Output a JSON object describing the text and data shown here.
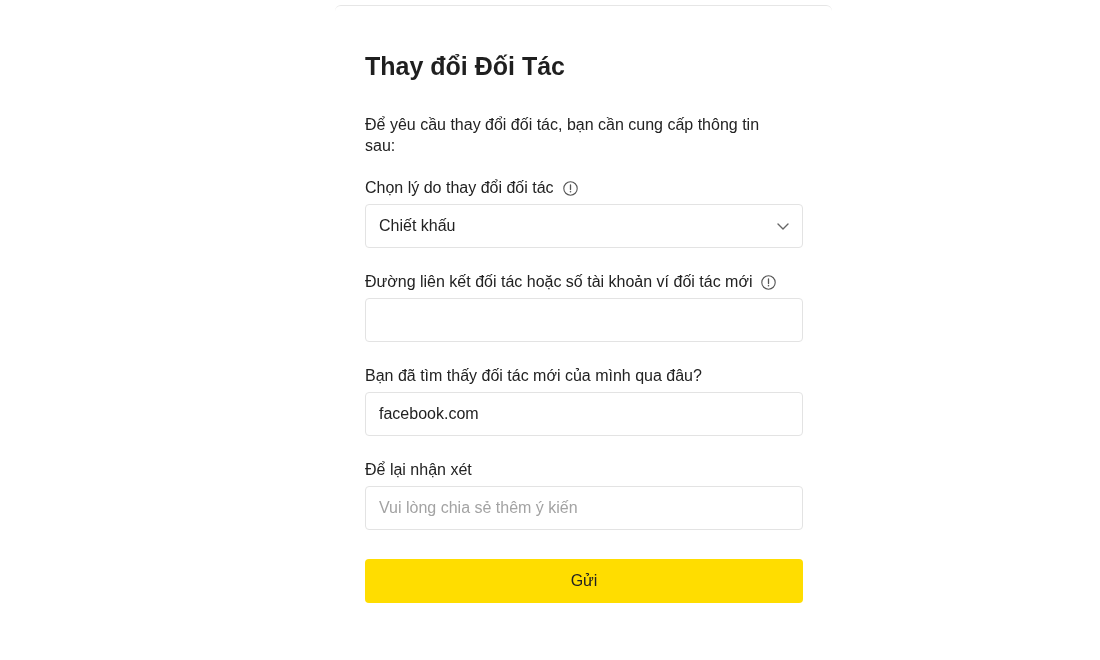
{
  "form": {
    "title": "Thay đổi Đối Tác",
    "intro": "Để yêu cầu thay đổi đối tác, bạn cần cung cấp thông tin sau:",
    "fields": [
      {
        "kind": "select",
        "label": "Chọn lý do thay đổi đối tác",
        "info_icon": true,
        "value": "Chiết khấu"
      },
      {
        "kind": "text",
        "label": "Đường liên kết đối tác hoặc số tài khoản ví đối tác mới",
        "info_icon": true
      },
      {
        "kind": "text",
        "label": "Bạn đã tìm thấy đối tác mới của mình qua đâu?",
        "info_icon": false,
        "value": "facebook.com"
      },
      {
        "kind": "text",
        "label": "Để lại nhận xét",
        "info_icon": false,
        "placeholder": "Vui lòng chia sẻ thêm ý kiến"
      }
    ],
    "submit_button": "Gửi"
  }
}
